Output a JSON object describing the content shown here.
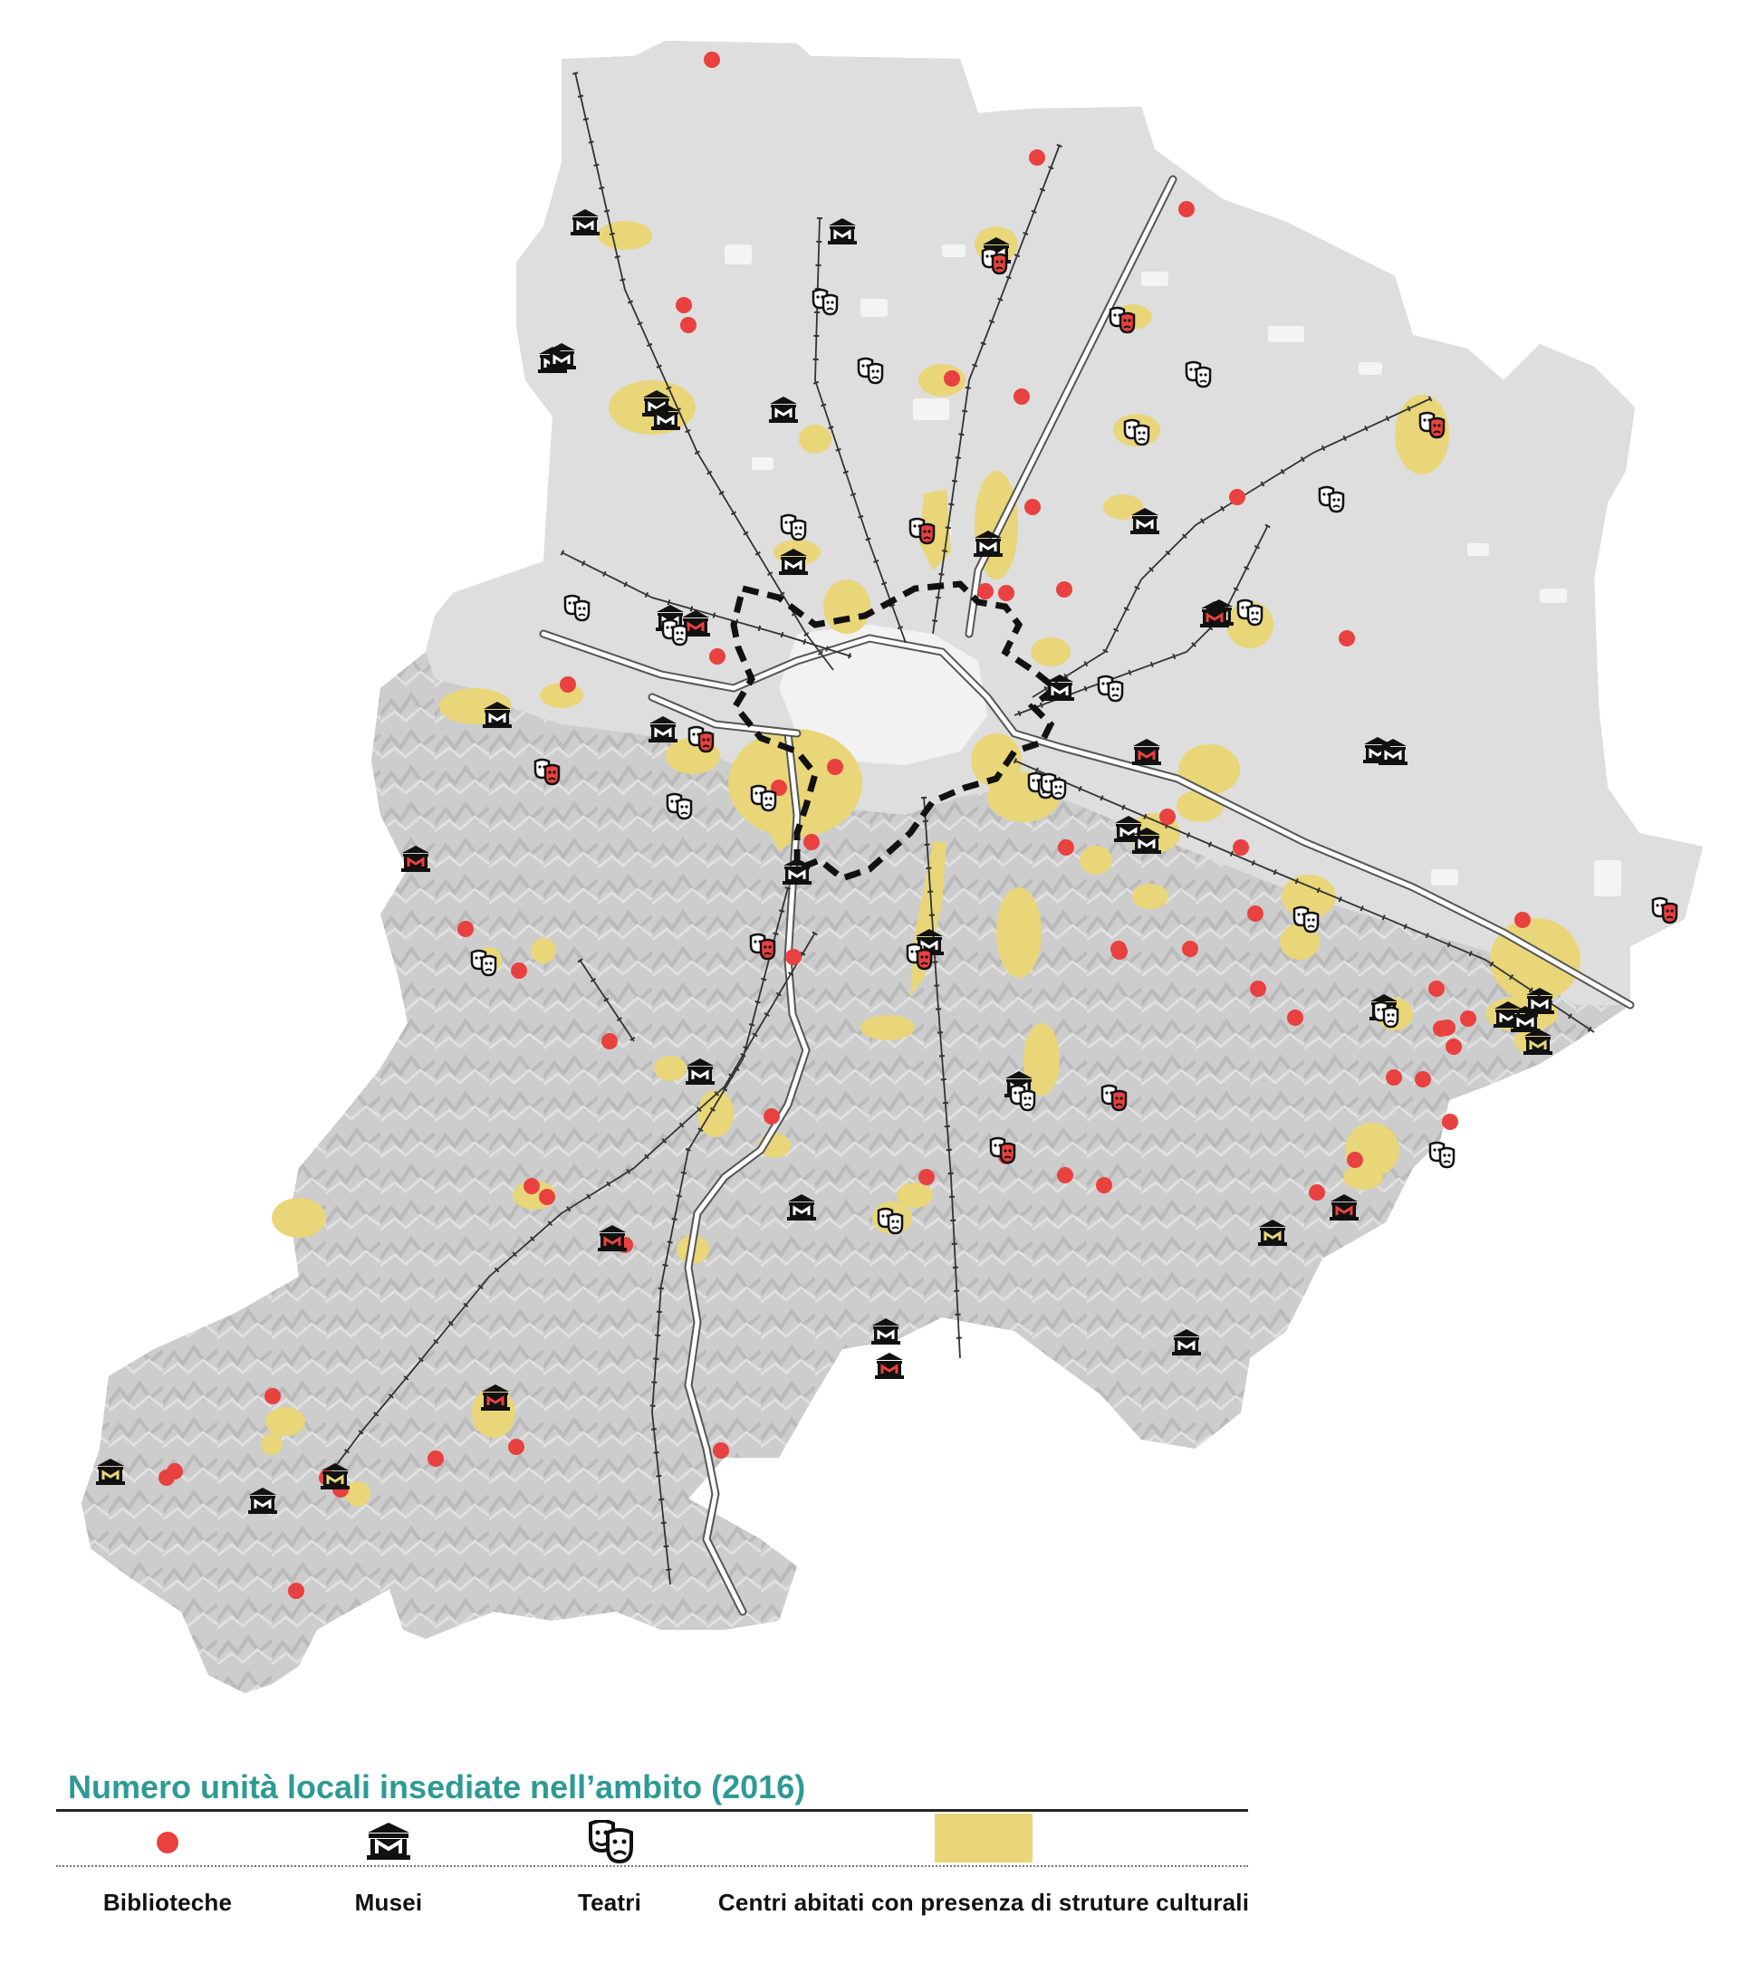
{
  "legend": {
    "title": "Numero unità locali insediate nell’ambito (2016)",
    "items": [
      {
        "key": "biblioteche",
        "label": "Biblioteche",
        "icon": "red-dot"
      },
      {
        "key": "musei",
        "label": "Musei",
        "icon": "museum-icon"
      },
      {
        "key": "teatri",
        "label": "Teatri",
        "icon": "theatre-masks-icon"
      },
      {
        "key": "centri",
        "label": "Centri abitati con presenza di struture culturali",
        "icon": "yellow-area"
      }
    ]
  },
  "colors": {
    "library": "#e8413f",
    "museum": "#111111",
    "museum_red": "#e8413f",
    "museum_yellow": "#e8d679",
    "theatre": "#111111",
    "settlement": "#e8d679",
    "plain": "#dedede",
    "mountain": "#c9c9c9",
    "city": "#f2f2f2",
    "legend_title": "#2e9a94"
  }
}
